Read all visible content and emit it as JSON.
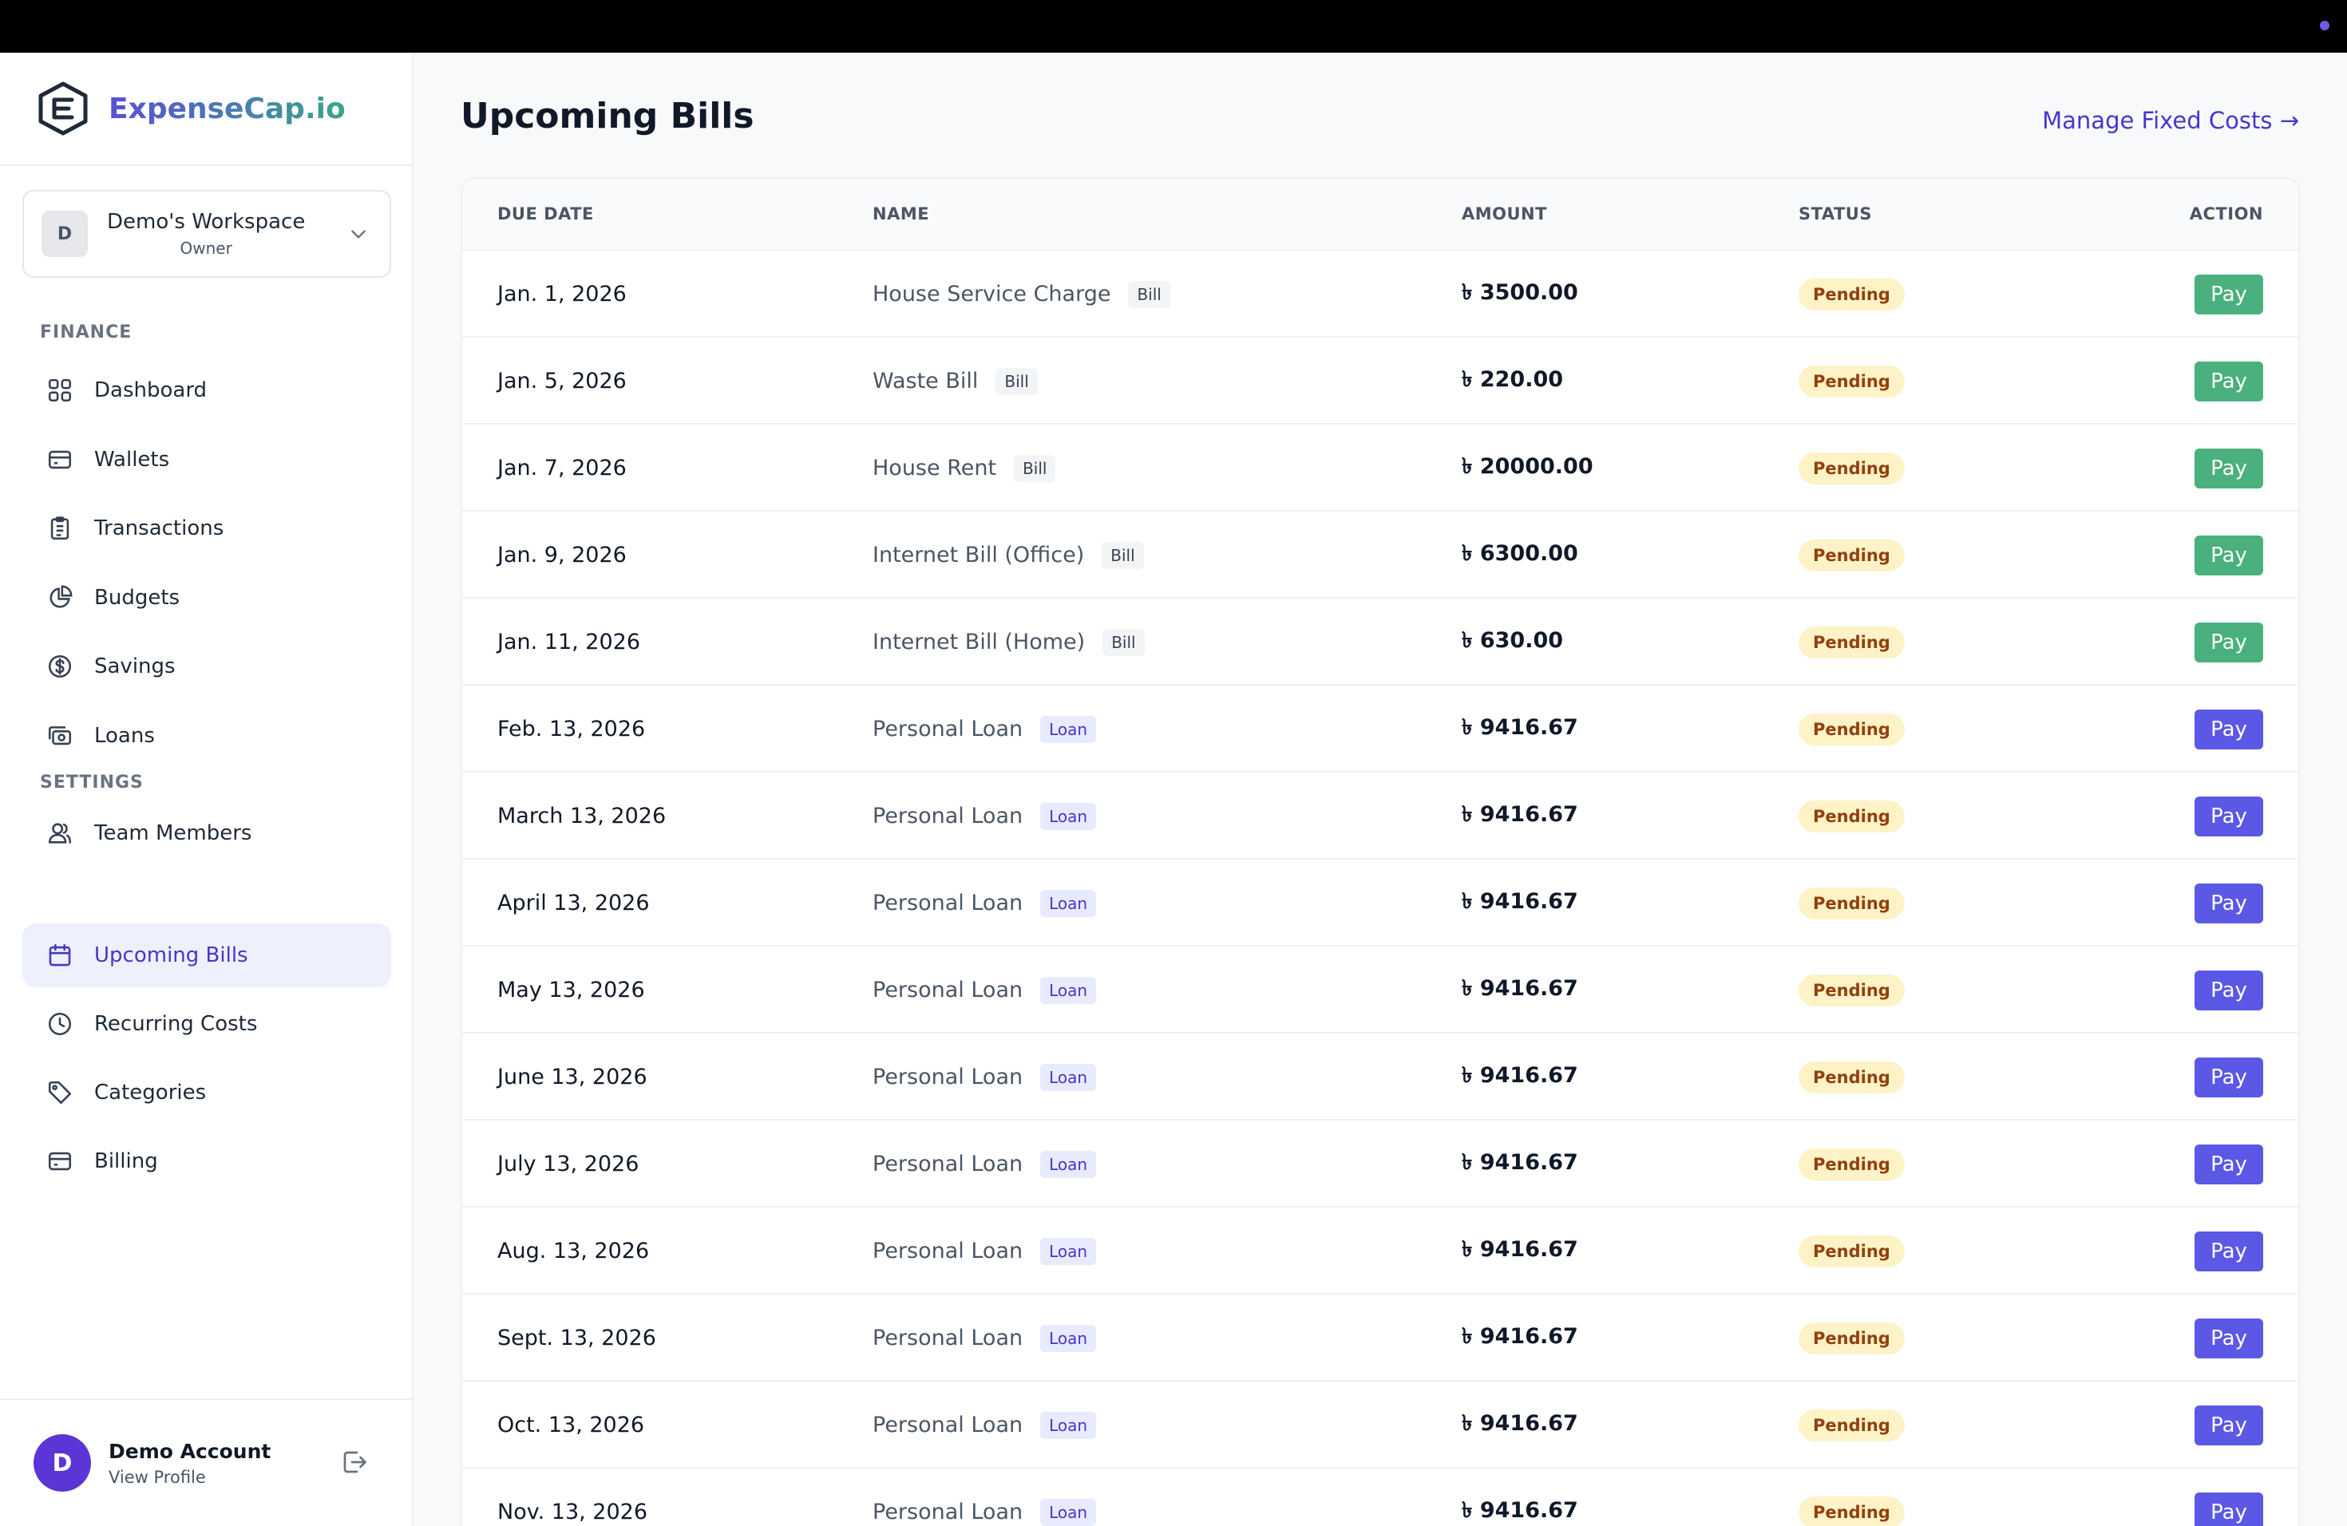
{
  "brand": {
    "name": "ExpenseCap.io"
  },
  "workspace": {
    "initial": "D",
    "name": "Demo's Workspace",
    "role": "Owner"
  },
  "sidebar": {
    "finance_label": "FINANCE",
    "settings_label": "SETTINGS",
    "finance_items": [
      {
        "label": "Dashboard",
        "icon": "grid-icon"
      },
      {
        "label": "Wallets",
        "icon": "wallet-icon"
      },
      {
        "label": "Transactions",
        "icon": "clipboard-icon"
      },
      {
        "label": "Budgets",
        "icon": "pie-chart-icon"
      },
      {
        "label": "Savings",
        "icon": "dollar-circle-icon"
      },
      {
        "label": "Loans",
        "icon": "cash-icon"
      }
    ],
    "settings_items": [
      {
        "label": "Team Members",
        "icon": "users-icon"
      },
      {
        "label": "Upcoming Bills",
        "icon": "calendar-icon",
        "active": true
      },
      {
        "label": "Recurring Costs",
        "icon": "clock-icon"
      },
      {
        "label": "Categories",
        "icon": "tag-icon"
      },
      {
        "label": "Billing",
        "icon": "credit-card-icon"
      }
    ]
  },
  "account": {
    "initial": "D",
    "name": "Demo Account",
    "profile_link": "View Profile"
  },
  "main": {
    "title": "Upcoming Bills",
    "manage_link": "Manage Fixed Costs →",
    "columns": {
      "due": "DUE DATE",
      "name": "NAME",
      "amount": "AMOUNT",
      "status": "STATUS",
      "action": "ACTION"
    },
    "rows": [
      {
        "due": "Jan. 1, 2026",
        "name": "House Service Charge",
        "tag": "Bill",
        "amount": "৳ 3500.00",
        "status": "Pending",
        "action": "Pay"
      },
      {
        "due": "Jan. 5, 2026",
        "name": "Waste Bill",
        "tag": "Bill",
        "amount": "৳ 220.00",
        "status": "Pending",
        "action": "Pay"
      },
      {
        "due": "Jan. 7, 2026",
        "name": "House Rent",
        "tag": "Bill",
        "amount": "৳ 20000.00",
        "status": "Pending",
        "action": "Pay"
      },
      {
        "due": "Jan. 9, 2026",
        "name": "Internet Bill (Office)",
        "tag": "Bill",
        "amount": "৳ 6300.00",
        "status": "Pending",
        "action": "Pay"
      },
      {
        "due": "Jan. 11, 2026",
        "name": "Internet Bill (Home)",
        "tag": "Bill",
        "amount": "৳ 630.00",
        "status": "Pending",
        "action": "Pay"
      },
      {
        "due": "Feb. 13, 2026",
        "name": "Personal Loan",
        "tag": "Loan",
        "amount": "৳ 9416.67",
        "status": "Pending",
        "action": "Pay"
      },
      {
        "due": "March 13, 2026",
        "name": "Personal Loan",
        "tag": "Loan",
        "amount": "৳ 9416.67",
        "status": "Pending",
        "action": "Pay"
      },
      {
        "due": "April 13, 2026",
        "name": "Personal Loan",
        "tag": "Loan",
        "amount": "৳ 9416.67",
        "status": "Pending",
        "action": "Pay"
      },
      {
        "due": "May 13, 2026",
        "name": "Personal Loan",
        "tag": "Loan",
        "amount": "৳ 9416.67",
        "status": "Pending",
        "action": "Pay"
      },
      {
        "due": "June 13, 2026",
        "name": "Personal Loan",
        "tag": "Loan",
        "amount": "৳ 9416.67",
        "status": "Pending",
        "action": "Pay"
      },
      {
        "due": "July 13, 2026",
        "name": "Personal Loan",
        "tag": "Loan",
        "amount": "৳ 9416.67",
        "status": "Pending",
        "action": "Pay"
      },
      {
        "due": "Aug. 13, 2026",
        "name": "Personal Loan",
        "tag": "Loan",
        "amount": "৳ 9416.67",
        "status": "Pending",
        "action": "Pay"
      },
      {
        "due": "Sept. 13, 2026",
        "name": "Personal Loan",
        "tag": "Loan",
        "amount": "৳ 9416.67",
        "status": "Pending",
        "action": "Pay"
      },
      {
        "due": "Oct. 13, 2026",
        "name": "Personal Loan",
        "tag": "Loan",
        "amount": "৳ 9416.67",
        "status": "Pending",
        "action": "Pay"
      },
      {
        "due": "Nov. 13, 2026",
        "name": "Personal Loan",
        "tag": "Loan",
        "amount": "৳ 9416.67",
        "status": "Pending",
        "action": "Pay"
      }
    ]
  },
  "colors": {
    "accent": "#4338ca",
    "bill_pay": "#4ab07d",
    "loan_pay": "#5b58e6",
    "pending_bg": "#fef3c7"
  }
}
